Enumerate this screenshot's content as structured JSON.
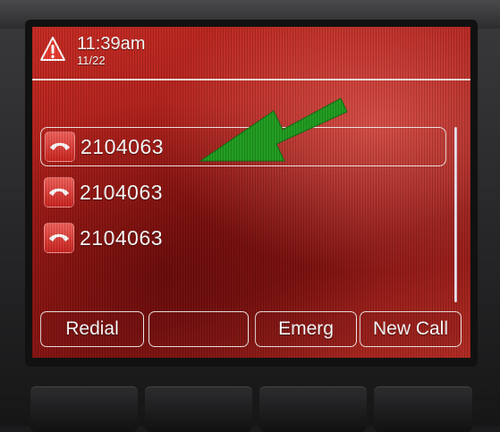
{
  "status": {
    "time": "11:39am",
    "date": "11/22",
    "alert_icon": "warning-triangle-icon"
  },
  "calls": [
    {
      "number": "2104063",
      "icon": "handset-icon",
      "selected": true
    },
    {
      "number": "2104063",
      "icon": "handset-icon",
      "selected": false
    },
    {
      "number": "2104063",
      "icon": "handset-icon",
      "selected": false
    }
  ],
  "softkeys": [
    {
      "label": "Redial"
    },
    {
      "label": ""
    },
    {
      "label": "Emerg"
    },
    {
      "label": "New Call"
    }
  ],
  "colors": {
    "screen": "#b3221c",
    "annotation_arrow": "#1f9a1f",
    "alert": "#e23a30"
  }
}
